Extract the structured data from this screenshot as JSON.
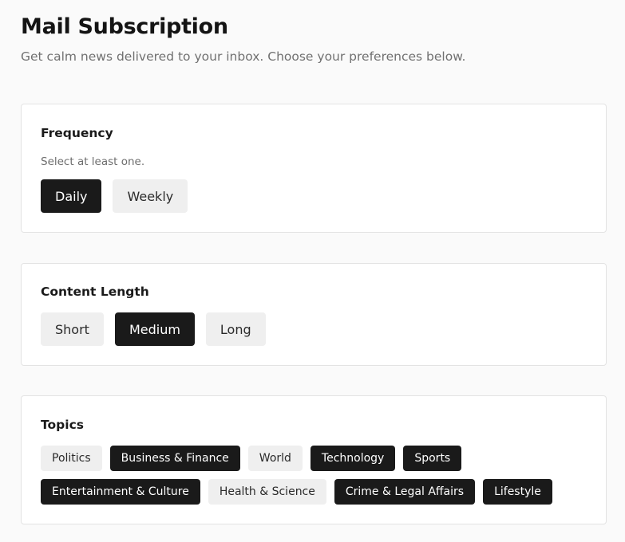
{
  "header": {
    "title": "Mail Subscription",
    "subtitle": "Get calm news delivered to your inbox. Choose your preferences below."
  },
  "frequency": {
    "title": "Frequency",
    "hint": "Select at least one.",
    "options": [
      {
        "label": "Daily",
        "selected": true
      },
      {
        "label": "Weekly",
        "selected": false
      }
    ]
  },
  "content_length": {
    "title": "Content Length",
    "options": [
      {
        "label": "Short",
        "selected": false
      },
      {
        "label": "Medium",
        "selected": true
      },
      {
        "label": "Long",
        "selected": false
      }
    ]
  },
  "topics": {
    "title": "Topics",
    "rows": [
      [
        {
          "label": "Politics",
          "selected": false
        },
        {
          "label": "Business & Finance",
          "selected": true
        },
        {
          "label": "World",
          "selected": false
        },
        {
          "label": "Technology",
          "selected": true
        },
        {
          "label": "Sports",
          "selected": true
        }
      ],
      [
        {
          "label": "Entertainment & Culture",
          "selected": true
        },
        {
          "label": "Health & Science",
          "selected": false
        },
        {
          "label": "Crime & Legal Affairs",
          "selected": true
        },
        {
          "label": "Lifestyle",
          "selected": true
        }
      ]
    ]
  },
  "colors": {
    "selected_bg": "#1a1a1a",
    "unselected_bg": "#efefef",
    "page_bg": "#fafafa",
    "card_border": "#e3e3e3"
  }
}
